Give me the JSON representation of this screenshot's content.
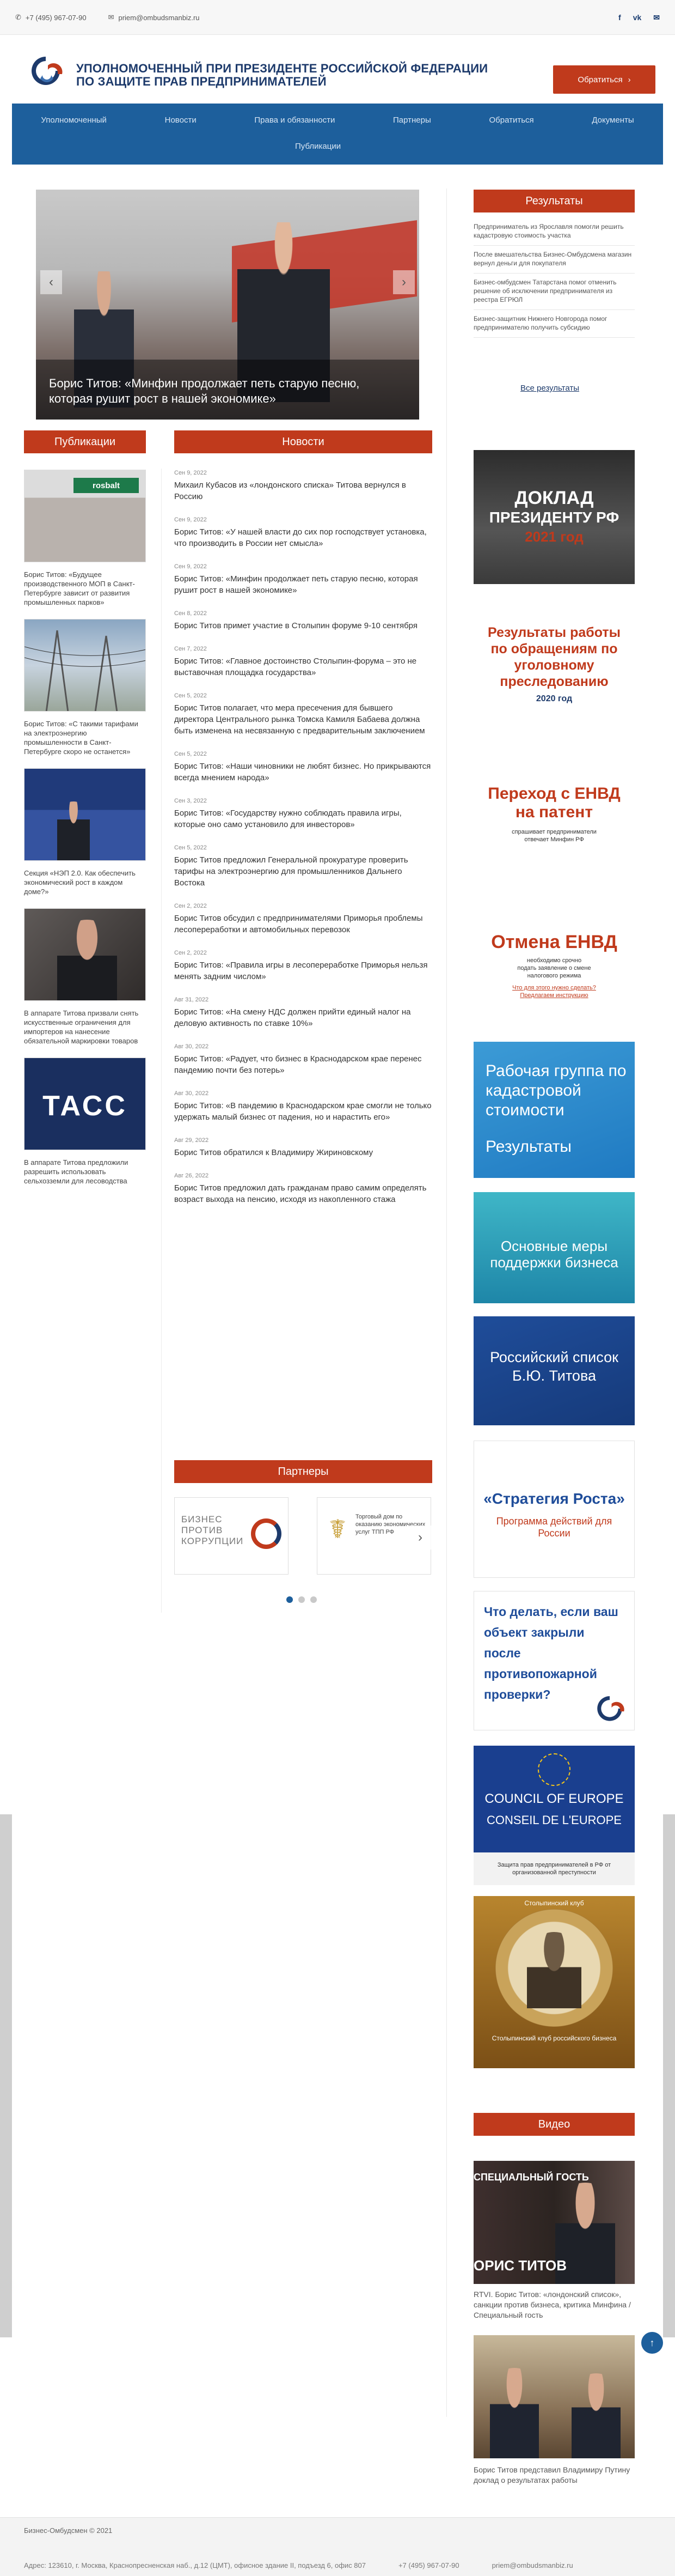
{
  "topbar": {
    "phone": "+7 (495) 967-07-90",
    "email": "priem@ombudsmanbiz.ru",
    "socials": [
      "f",
      "vk",
      "✉"
    ]
  },
  "header": {
    "brand_line1": "УПОЛНОМОЧЕННЫЙ ПРИ ПРЕЗИДЕНТЕ РОССИЙСКОЙ ФЕДЕРАЦИИ",
    "brand_line2": "ПО ЗАЩИТЕ ПРАВ ПРЕДПРИНИМАТЕЛЕЙ",
    "cta_label": "Обратиться"
  },
  "nav": {
    "row1": [
      "Уполномоченный",
      "Новости",
      "Права и обязанности",
      "Партнеры",
      "Обратиться",
      "Документы"
    ],
    "row2": [
      "Публикации"
    ]
  },
  "slider": {
    "caption": "Борис Титов: «Минфин продолжает петь старую песню, которая рушит рост в нашей экономике»"
  },
  "sections": {
    "results": "Результаты",
    "publications": "Публикации",
    "news": "Новости",
    "partners": "Партнеры",
    "video": "Видео"
  },
  "results": [
    "Предприниматель из Ярославля помогли решить кадастровую стоимость участка",
    "После вмешательства Бизнес-Омбудсмена магазин вернул деньги для покупателя",
    "Бизнес-омбудсмен Татарстана помог отменить решение об исключении предпринимателя из реестра ЕГРЮЛ",
    "Бизнес-защитник Нижнего Новгорода помог предпринимателю получить субсидию"
  ],
  "all_results": "Все результаты",
  "publications": [
    {
      "caption": "Борис Титов: «Будущее производственного МОП в Санкт-Петербурге зависит от развития промышленных парков»",
      "thumb": "rosbalt"
    },
    {
      "caption": "Борис Титов: «С такими тарифами на электроэнергию промышленности в Санкт-Петербурге скоро не останется»",
      "thumb": "power-lines"
    },
    {
      "caption": "Секция «НЭП 2.0. Как обеспечить экономический рост в каждом доме?»",
      "thumb": "conference"
    },
    {
      "caption": "В аппарате Титова призвали снять искусственные ограничения для импортеров на нанесение обязательной маркировки товаров",
      "thumb": "portrait"
    },
    {
      "caption": "В аппарате Титова предложили разрешить использовать сельхозземли для лесоводства",
      "thumb": "tass"
    }
  ],
  "news": [
    {
      "date": "Сен 9, 2022",
      "title": "Михаил Кубасов из «лондонского списка» Титова вернулся в Россию"
    },
    {
      "date": "Сен 9, 2022",
      "title": "Борис Титов: «У нашей власти до сих пор господствует установка, что производить в России нет смысла»"
    },
    {
      "date": "Сен 9, 2022",
      "title": "Борис Титов: «Минфин продолжает петь старую песню, которая рушит рост в нашей экономике»"
    },
    {
      "date": "Сен 8, 2022",
      "title": "Борис Титов примет участие в Столыпин форуме 9-10 сентября"
    },
    {
      "date": "Сен 7, 2022",
      "title": "Борис Титов: «Главное достоинство Столыпин-форума – это не выставочная площадка государства»"
    },
    {
      "date": "Сен 5, 2022",
      "title": "Борис Титов полагает, что мера пресечения для бывшего директора Центрального рынка Томска Камиля Бабаева должна быть изменена на несвязанную с предварительным заключением"
    },
    {
      "date": "Сен 5, 2022",
      "title": "Борис Титов: «Наши чиновники не любят бизнес. Но прикрываются всегда мнением народа»"
    },
    {
      "date": "Сен 3, 2022",
      "title": "Борис Титов: «Государству нужно соблюдать правила игры, которые оно само установило для инвесторов»"
    },
    {
      "date": "Сен 5, 2022",
      "title": "Борис Титов предложил Генеральной прокуратуре проверить тарифы на электроэнергию для промышленников Дальнего Востока"
    },
    {
      "date": "Сен 2, 2022",
      "title": "Борис Титов обсудил с предпринимателями Приморья проблемы лесопереработки и автомобильных перевозок"
    },
    {
      "date": "Сен 2, 2022",
      "title": "Борис Титов: «Правила игры в лесопереработке Приморья нельзя менять задним числом»"
    },
    {
      "date": "Авг 31, 2022",
      "title": "Борис Титов: «На смену НДС должен прийти единый налог на деловую активность по ставке 10%»"
    },
    {
      "date": "Авг 30, 2022",
      "title": "Борис Титов: «Радует, что бизнес в Краснодарском крае перенес пандемию почти без потерь»"
    },
    {
      "date": "Авг 30, 2022",
      "title": "Борис Титов: «В пандемию в Краснодарском крае смогли не только удержать малый бизнес от падения, но и нарастить его»"
    },
    {
      "date": "Авг 29, 2022",
      "title": "Борис Титов обратился к Владимиру Жириновскому"
    },
    {
      "date": "Авг 26, 2022",
      "title": "Борис Титов предложил дать гражданам право самим определять возраст выхода на пенсию, исходя из накопленного стажа"
    }
  ],
  "partners": [
    {
      "name": "БИЗНЕС ПРОТИВ КОРРУПЦИИ"
    },
    {
      "name": "Торговый дом по оказанию экономических услуг ТПП РФ"
    }
  ],
  "banners": {
    "report": {
      "line1": "ДОКЛАД",
      "line2": "ПРЕЗИДЕНТУ РФ",
      "year": "2021 год"
    },
    "criminal": {
      "line1": "Результаты работы по обращениям по уголовному преследованию",
      "year": "2020 год"
    },
    "envd_patent": {
      "line1": "Переход с ЕНВД на патент",
      "sub": "спрашивает предприниматели отвечает Минфин РФ"
    },
    "envd_cancel": {
      "line1": "Отмена ЕНВД",
      "sub": "необходимо срочно подать заявление о смене налогового режима",
      "link": "Что для этого нужно сделать? Предлагаем инструкцию"
    },
    "cadastral": {
      "line1": "Рабочая группа по кадастровой стоимости",
      "line2": "Результаты"
    },
    "support": {
      "line1": "Основные меры поддержки бизнеса"
    },
    "list": {
      "line1": "Российский список Б.Ю. Титова"
    },
    "strategy": {
      "line1": "«Стратегия Роста»",
      "line2": "Программа действий для России"
    },
    "fire": {
      "line1": "Что делать, если ваш объект закрыли после противопожарной проверки?"
    },
    "council": {
      "line1": "COUNCIL OF EUROPE",
      "line2": "CONSEIL DE L'EUROPE",
      "sub": "Защита прав предпринимателей в РФ от организованной преступности"
    },
    "club": {
      "line1": "Столыпинский клуб",
      "line2": "Столыпинский клуб российского бизнеса"
    }
  },
  "videos": [
    {
      "caption": "RTVI. Борис Титов: «лондонский список», санкции против бизнеса, критика Минфина / Специальный гость",
      "overlay_top": "СПЕЦИАЛЬНЫЙ ГОСТЬ",
      "overlay_bottom": "ОРИС ТИТОВ"
    },
    {
      "caption": "Борис Титов представил Владимиру Путину доклад о результатах работы"
    }
  ],
  "footer": {
    "copyright": "Бизнес-Омбудсмен © 2021",
    "address": "Адрес: 123610, г. Москва, Краснопресненская наб., д.12 (ЦМТ), офисное здание II, подъезд 6, офис 807",
    "phone": "+7 (495) 967-07-90",
    "email": "priem@ombudsmanbiz.ru"
  }
}
